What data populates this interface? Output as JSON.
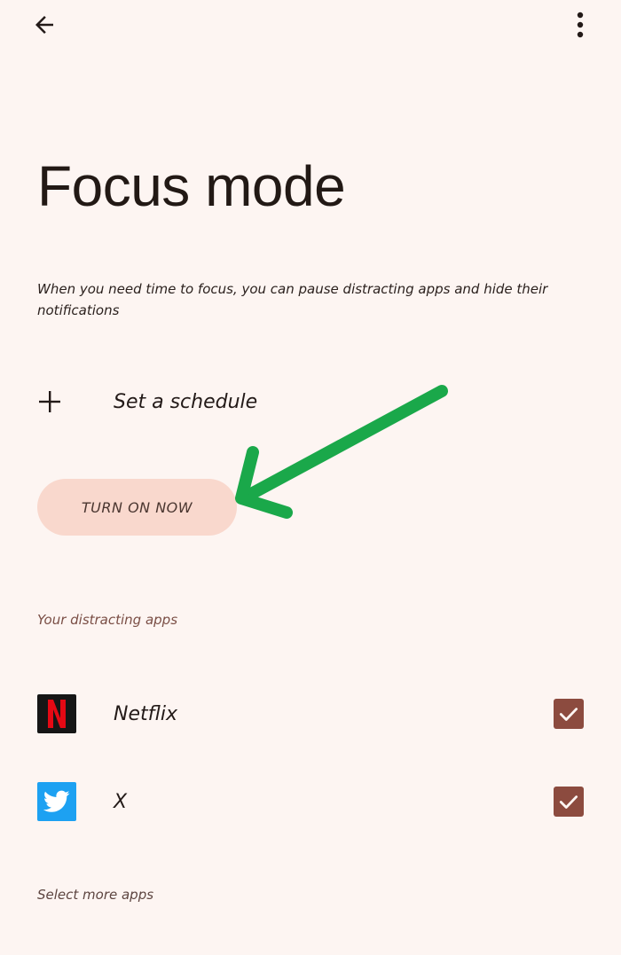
{
  "header": {
    "back_icon": "arrow-back-icon",
    "more_icon": "more-vert-icon"
  },
  "page": {
    "title": "Focus mode",
    "description": "When you need time to focus, you can pause distracting apps and hide their notifications"
  },
  "schedule": {
    "icon": "plus-icon",
    "label": "Set a schedule"
  },
  "primary_action": {
    "label": "TURN ON NOW"
  },
  "distracting_apps": {
    "header": "Your distracting apps",
    "apps": [
      {
        "name": "Netflix",
        "icon": "netflix-icon",
        "checked": true
      },
      {
        "name": "X",
        "icon": "twitter-icon",
        "checked": true
      }
    ],
    "select_more_label": "Select more apps"
  },
  "colors": {
    "background": "#fdf5f2",
    "button_bg": "#f9d8cd",
    "checkbox": "#8c4b3f",
    "annotation_arrow": "#1aa84a",
    "section_header": "#7a4e45"
  }
}
